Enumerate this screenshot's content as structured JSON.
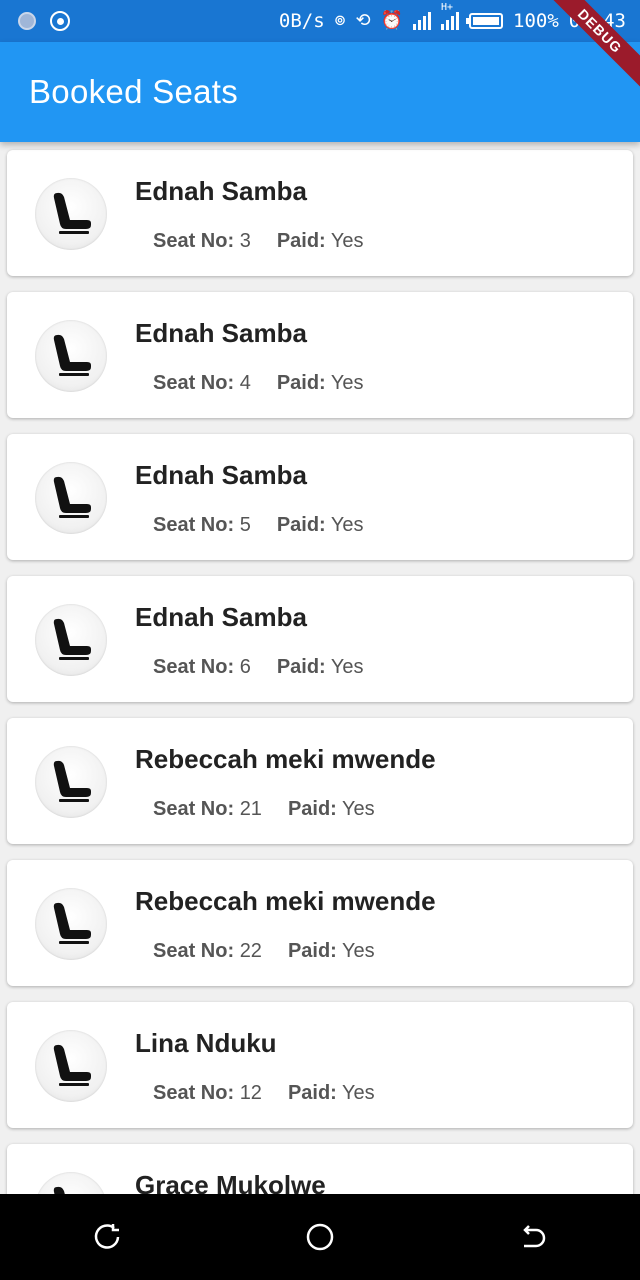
{
  "status_bar": {
    "net_speed": "0B/s",
    "battery": "100%",
    "time": "01:43",
    "network_type": "H+"
  },
  "debug_banner": "DEBUG",
  "app_bar": {
    "title": "Booked Seats"
  },
  "labels": {
    "seat_no": "Seat No:",
    "paid": "Paid:"
  },
  "bookings": [
    {
      "name": "Ednah Samba",
      "seat": "3",
      "paid": "Yes"
    },
    {
      "name": "Ednah Samba",
      "seat": "4",
      "paid": "Yes"
    },
    {
      "name": "Ednah Samba",
      "seat": "5",
      "paid": "Yes"
    },
    {
      "name": "Ednah Samba",
      "seat": "6",
      "paid": "Yes"
    },
    {
      "name": "Rebeccah meki mwende",
      "seat": "21",
      "paid": "Yes"
    },
    {
      "name": "Rebeccah meki mwende",
      "seat": "22",
      "paid": "Yes"
    },
    {
      "name": "Lina Nduku",
      "seat": "12",
      "paid": "Yes"
    },
    {
      "name": "Grace Mukolwe"
    }
  ],
  "nav_bar": {
    "buttons": [
      "recent-apps-icon",
      "home-icon",
      "back-icon"
    ]
  }
}
